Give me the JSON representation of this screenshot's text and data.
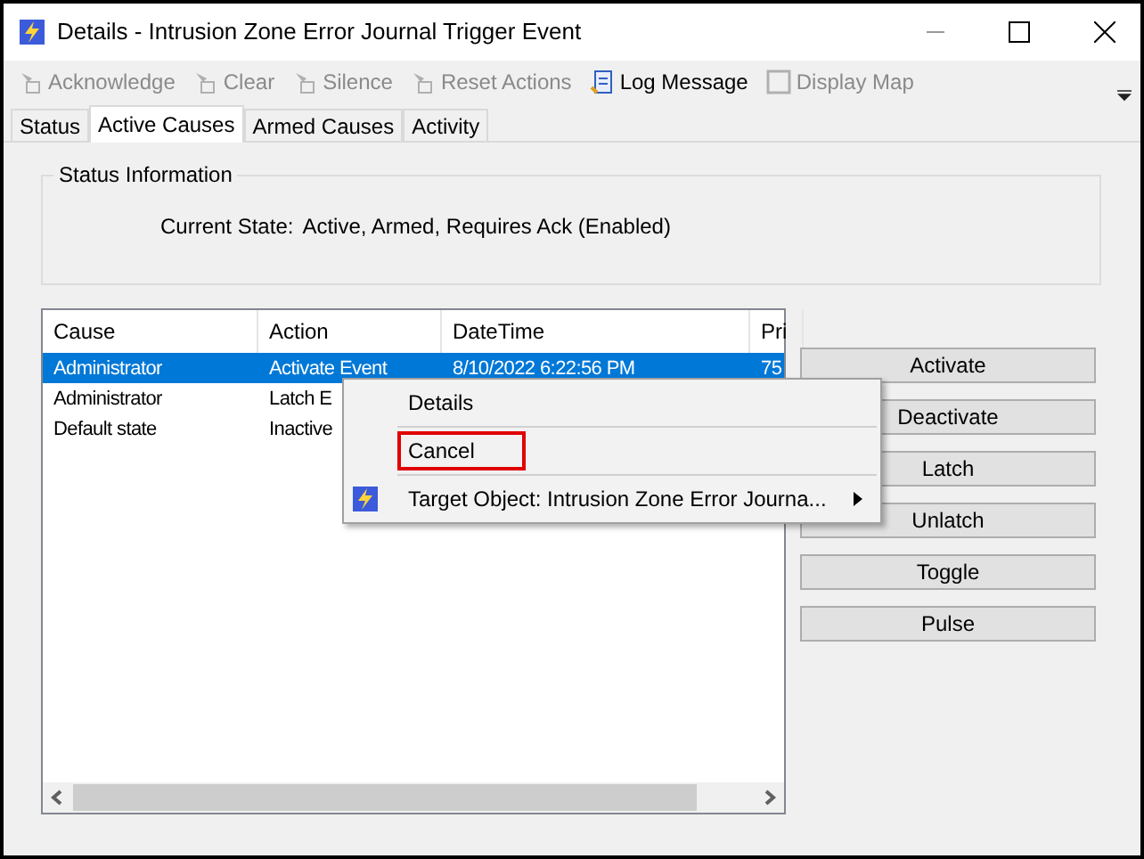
{
  "window": {
    "title": "Details - Intrusion Zone Error Journal Trigger Event"
  },
  "toolbar": [
    {
      "label": "Acknowledge",
      "disabled": true
    },
    {
      "label": "Clear",
      "disabled": true
    },
    {
      "label": "Silence",
      "disabled": true
    },
    {
      "label": "Reset Actions",
      "disabled": true
    },
    {
      "label": "Log Message",
      "disabled": false
    },
    {
      "label": "Display Map",
      "disabled": true
    }
  ],
  "tabs": [
    {
      "label": "Status",
      "selected": false
    },
    {
      "label": "Active Causes",
      "selected": true
    },
    {
      "label": "Armed Causes",
      "selected": false
    },
    {
      "label": "Activity",
      "selected": false
    }
  ],
  "status_information": {
    "title": "Status Information",
    "label": "Current State:",
    "value": "Active, Armed, Requires Ack (Enabled)"
  },
  "table": {
    "columns": [
      "Cause",
      "Action",
      "DateTime",
      "Pri"
    ],
    "rows": [
      {
        "cells": [
          "Administrator",
          "Activate Event",
          "8/10/2022 6:22:56 PM",
          "75"
        ],
        "selected": true
      },
      {
        "cells": [
          "Administrator",
          "Latch E"
        ],
        "selected": false
      },
      {
        "cells": [
          "Default state",
          "Inactive"
        ],
        "selected": false
      }
    ]
  },
  "buttons": [
    "Activate",
    "Deactivate",
    "Latch",
    "Unlatch",
    "Toggle",
    "Pulse"
  ],
  "context_menu": [
    {
      "label": "Details",
      "kind": "item",
      "highlighted": false
    },
    {
      "label": "Cancel",
      "kind": "item",
      "highlighted": true
    },
    {
      "label": "Target Object: Intrusion Zone Error Journa...",
      "kind": "submenu",
      "highlighted": false
    }
  ]
}
